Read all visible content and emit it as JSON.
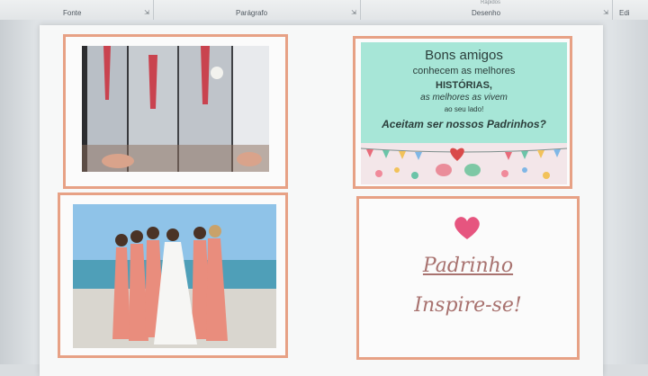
{
  "ribbon": {
    "groups": [
      {
        "label": "Fonte"
      },
      {
        "label": "Parágrafo"
      },
      {
        "label": "Desenho"
      },
      {
        "label": "Edi"
      }
    ],
    "faded_items": [
      "Rápidos"
    ]
  },
  "invite_card": {
    "line1": "Bons amigos",
    "line2": "conhecem as melhores",
    "line3": "HISTÓRIAS,",
    "line4": "as melhores as vivem",
    "line5": "ao seu lado!",
    "line6": "Aceitam ser nossos Padrinhos?"
  },
  "title_card": {
    "title": "Padrinho",
    "subtitle": "Inspire-se!"
  },
  "colors": {
    "border": "#e7a185",
    "invite_bg": "#a7e6d7",
    "heart": "#e6557f",
    "script_text": "#a8726f"
  }
}
